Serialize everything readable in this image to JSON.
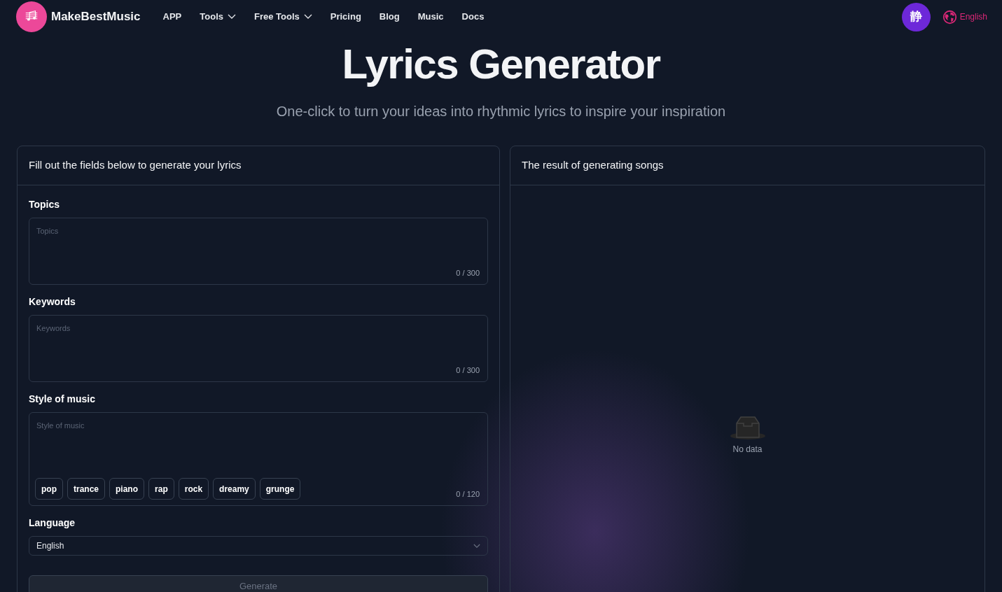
{
  "header": {
    "brand": "MakeBestMusic",
    "nav": [
      {
        "label": "APP",
        "dropdown": false
      },
      {
        "label": "Tools",
        "dropdown": true
      },
      {
        "label": "Free Tools",
        "dropdown": true
      },
      {
        "label": "Pricing",
        "dropdown": false
      },
      {
        "label": "Blog",
        "dropdown": false
      },
      {
        "label": "Music",
        "dropdown": false
      },
      {
        "label": "Docs",
        "dropdown": false
      }
    ],
    "avatar": "静",
    "language": "English"
  },
  "hero": {
    "title": "Lyrics Generator",
    "subtitle": "One-click to turn your ideas into rhythmic lyrics to inspire your inspiration"
  },
  "form": {
    "title": "Fill out the fields below to generate your lyrics",
    "fields": [
      {
        "kind": "textarea",
        "label": "Topics",
        "placeholder": "Topics",
        "counter": "0 / 300"
      },
      {
        "kind": "textarea",
        "label": "Keywords",
        "placeholder": "Keywords",
        "counter": "0 / 300"
      },
      {
        "kind": "tags",
        "label": "Style of music",
        "placeholder": "Style of music",
        "counter": "0 / 120",
        "tags": [
          "pop",
          "trance",
          "piano",
          "rap",
          "rock",
          "dreamy",
          "grunge"
        ]
      },
      {
        "kind": "select",
        "label": "Language",
        "value": "English"
      }
    ],
    "submit": {
      "label": "Generate",
      "disabled": true
    }
  },
  "result": {
    "title": "The result of generating songs",
    "empty": "No data"
  }
}
